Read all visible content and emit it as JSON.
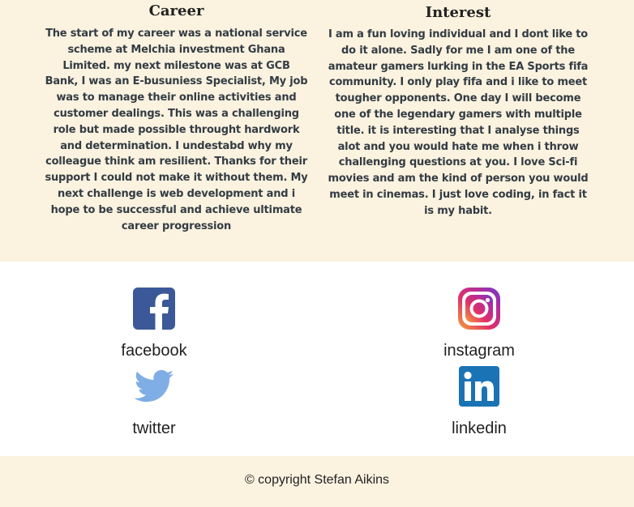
{
  "career": {
    "title": "Career",
    "text": "The start of my career was a national service scheme at Melchia investment Ghana Limited. my next milestone was at GCB Bank, I was an E-busuniess Specialist, My job was to manage their online activities and customer dealings. This was a challenging role but made possible throught hardwork and determination. I undestabd why my colleague think am resilient. Thanks for their support I could not make it without them. My next challenge is web development and i hope to be successful and achieve ultimate career progression"
  },
  "interest": {
    "title": "Interest",
    "text": "I am a fun loving individual and I dont like to do it alone. Sadly for me I am one of the amateur gamers lurking in the EA Sports fifa community. I only play fifa and i like to meet tougher opponents. One day I will become one of the legendary gamers with multiple title. it is interesting that I analyse things alot and you would hate me when i throw challenging questions at you. I love Sci-fi movies and am the kind of person you would meet in cinemas. I just love coding, in fact it is my habit."
  },
  "social": {
    "facebook": {
      "label": "facebook",
      "icon": "facebook-icon",
      "color": "#3b5998"
    },
    "instagram": {
      "label": "instagram",
      "icon": "instagram-icon",
      "color": "#c13584"
    },
    "twitter": {
      "label": "twitter",
      "icon": "twitter-icon",
      "color": "#7faee6"
    },
    "linkedin": {
      "label": "linkedin",
      "icon": "linkedin-icon",
      "color": "#1a73b5"
    }
  },
  "footer": {
    "copyright": "© copyright Stefan Aikins"
  },
  "colors": {
    "section_background": "#fbf2df",
    "text": "#333c44"
  }
}
